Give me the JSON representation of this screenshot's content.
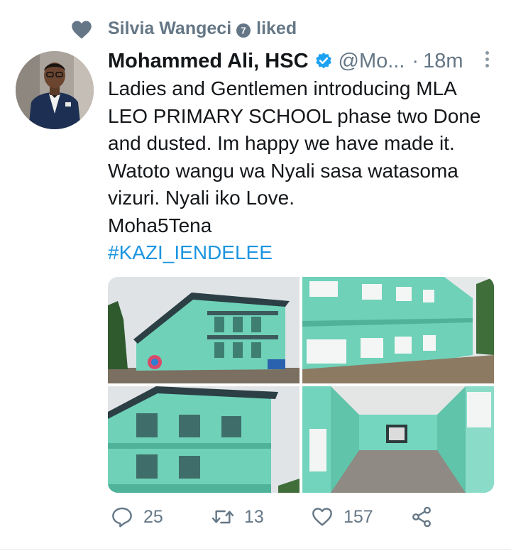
{
  "social_context": {
    "name": "Silvia Wangeci",
    "badge_number": "7",
    "action": "liked"
  },
  "tweet": {
    "author_name": "Mohammed Ali, HSC",
    "handle": "@Mo...",
    "separator": "·",
    "time": "18m",
    "text_lines": [
      "Ladies and Gentlemen introducing MLA",
      "LEO PRIMARY SCHOOL phase two Done",
      "and dusted. Im happy we have made it.",
      "Watoto wangu wa Nyali sasa watasoma",
      "vizuri. Nyali iko Love.",
      "Moha5Tena"
    ],
    "hashtag": "#KAZI_IENDELEE"
  },
  "actions": {
    "replies": "25",
    "retweets": "13",
    "likes": "157"
  },
  "colors": {
    "text": "#14171a",
    "muted": "#657786",
    "link": "#1b95e0",
    "building": "#6fd1b8"
  }
}
